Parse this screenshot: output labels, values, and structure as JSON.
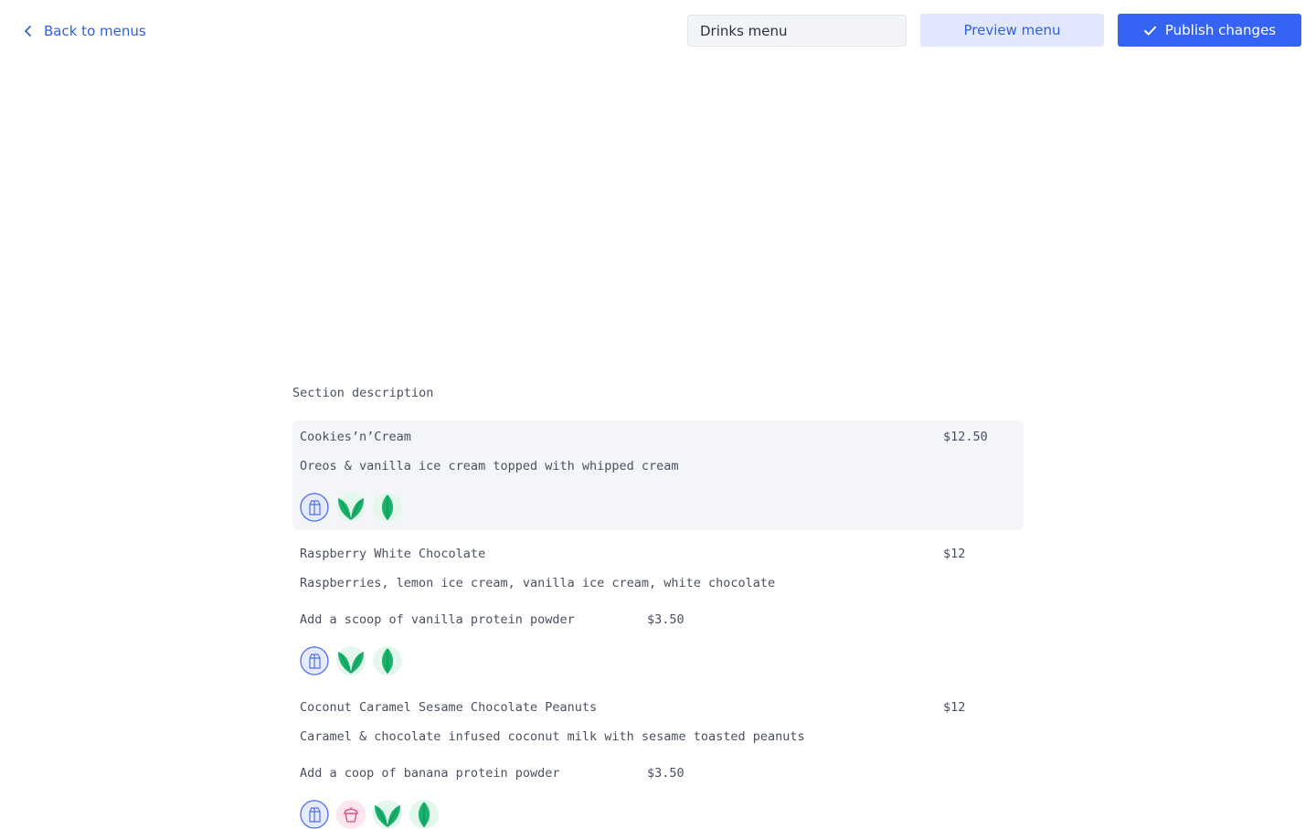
{
  "header": {
    "back_label": "Back to menus",
    "menu_name": "Drinks menu",
    "preview_label": "Preview menu",
    "publish_label": "Publish changes"
  },
  "section": {
    "description": "Section description"
  },
  "items": [
    {
      "name": "Cookies’n’Cream",
      "price": "$12.50",
      "description": "Oreos & vanilla ice cream topped with whipped cream",
      "icons": [
        "milk-carton-icon",
        "vegan-leaves-icon",
        "vegetarian-leaf-icon"
      ]
    },
    {
      "name": "Raspberry White Chocolate",
      "price": "$12",
      "description": "Raspberries, lemon ice cream, vanilla ice cream, white chocolate",
      "addon": "Add a scoop of vanilla protein powder",
      "addon_price": "$3.50",
      "icons": [
        "milk-carton-icon",
        "vegan-leaves-icon",
        "vegetarian-leaf-icon"
      ]
    },
    {
      "name": "Coconut Caramel Sesame Chocolate Peanuts",
      "price": "$12",
      "description": "Caramel & chocolate infused coconut milk with sesame toasted peanuts",
      "addon": "Add a coop of banana protein powder",
      "addon_price": "$3.50",
      "icons": [
        "milk-carton-icon",
        "nut-allergen-icon",
        "vegan-leaves-icon",
        "vegetarian-leaf-icon"
      ]
    }
  ],
  "colors": {
    "accent": "#3563f4",
    "accent_light": "#e1e7fd",
    "allergen_blue": "#4d6ef2",
    "green": "#17b26a",
    "pink": "#e0467c"
  }
}
